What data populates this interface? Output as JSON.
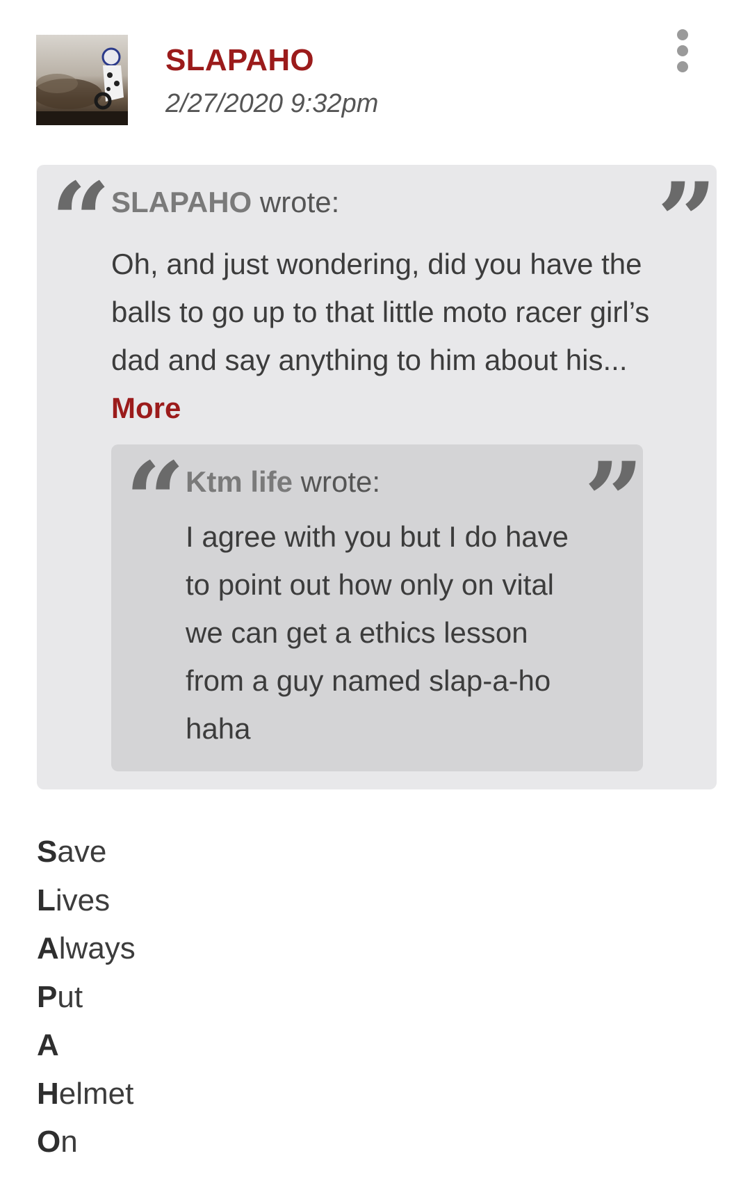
{
  "post": {
    "author": "SLAPAHO",
    "date": "2/27/2020 9:32pm",
    "avatar_icon": "motocross-rider-avatar",
    "menu_icon": "more-vertical-icon"
  },
  "quote_outer": {
    "author": "SLAPAHO",
    "wrote_label": " wrote:",
    "text": "Oh, and just wondering, did you have the balls to go up to that little moto racer girl’s dad and say anything to him about his... ",
    "more_label": "More"
  },
  "quote_inner": {
    "author": "Ktm life",
    "wrote_label": " wrote:",
    "text": "I agree with you but I do have to point out how only on vital we can get a ethics lesson from a guy named slap-a-ho haha"
  },
  "quote_marks": {
    "open": "“",
    "close": "”"
  },
  "signature": [
    {
      "initial": "S",
      "rest": "ave"
    },
    {
      "initial": "L",
      "rest": "ives"
    },
    {
      "initial": "A",
      "rest": "lways"
    },
    {
      "initial": "P",
      "rest": "ut"
    },
    {
      "initial": "A",
      "rest": ""
    },
    {
      "initial": "H",
      "rest": "elmet"
    },
    {
      "initial": "O",
      "rest": "n"
    }
  ],
  "colors": {
    "accent": "#9b1b1b",
    "quote_outer_bg": "#e8e8ea",
    "quote_inner_bg": "#d4d4d6"
  }
}
